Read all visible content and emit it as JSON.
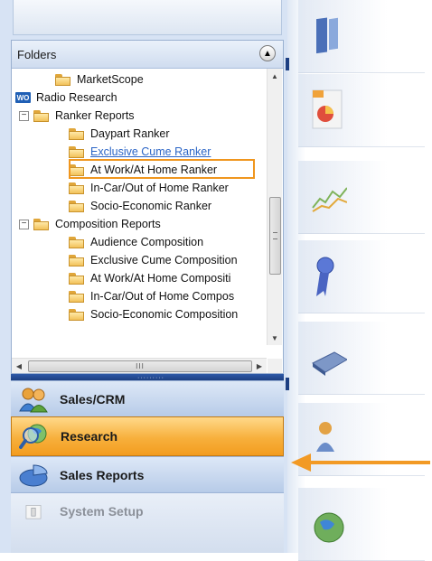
{
  "folders_panel": {
    "title": "Folders",
    "tree": [
      {
        "label": "MarketScope",
        "type": "folder"
      },
      {
        "label": "Radio Research",
        "type": "wo-root",
        "badge": "WO"
      },
      {
        "label": "Ranker Reports",
        "type": "folder",
        "expander": "−"
      },
      {
        "label": "Daypart Ranker",
        "type": "folder"
      },
      {
        "label": "Exclusive Cume Ranker",
        "type": "folder",
        "selected": true
      },
      {
        "label": "At Work/At Home Ranker",
        "type": "folder"
      },
      {
        "label": "In-Car/Out of Home Ranker",
        "type": "folder"
      },
      {
        "label": "Socio-Economic Ranker",
        "type": "folder"
      },
      {
        "label": "Composition Reports",
        "type": "folder",
        "expander": "−"
      },
      {
        "label": "Audience Composition",
        "type": "folder"
      },
      {
        "label": "Exclusive Cume Composition",
        "type": "folder"
      },
      {
        "label": "At Work/At Home Compositi",
        "type": "folder"
      },
      {
        "label": "In-Car/Out of Home Compos",
        "type": "folder"
      },
      {
        "label": "Socio-Economic Composition",
        "type": "folder"
      }
    ],
    "hscroll_grip": "III"
  },
  "nav": {
    "sales_crm": "Sales/CRM",
    "research": "Research",
    "sales_reports": "Sales Reports",
    "system_setup": "System Setup"
  },
  "colors": {
    "highlight_box": "#f0961e",
    "selected_link": "#2b65c6",
    "research_active": "#f7b03c",
    "pointer_arrow": "#f29a25"
  },
  "icons": {
    "collapse": "chevron-up-icon",
    "sales_crm": "people-icon",
    "research": "magnifier-globe-icon",
    "sales_reports": "pie-chart-icon",
    "system_setup": "settings-icon"
  }
}
